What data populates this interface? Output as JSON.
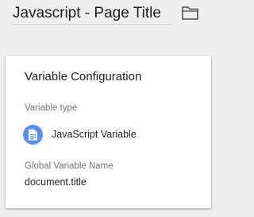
{
  "header": {
    "name_value": "Javascript - Page Title",
    "folder_icon": "folder-icon"
  },
  "card": {
    "title": "Variable Configuration",
    "variable_type_label": "Variable type",
    "variable_type": {
      "name": "JavaScript Variable",
      "icon": "document-icon",
      "icon_color": "#5b8def"
    },
    "global_variable_label": "Global Variable Name",
    "global_variable_value": "document.title"
  },
  "colors": {
    "background": "#eeeeee",
    "card": "#ffffff",
    "primary_text": "#212121",
    "secondary_text": "#757575"
  }
}
